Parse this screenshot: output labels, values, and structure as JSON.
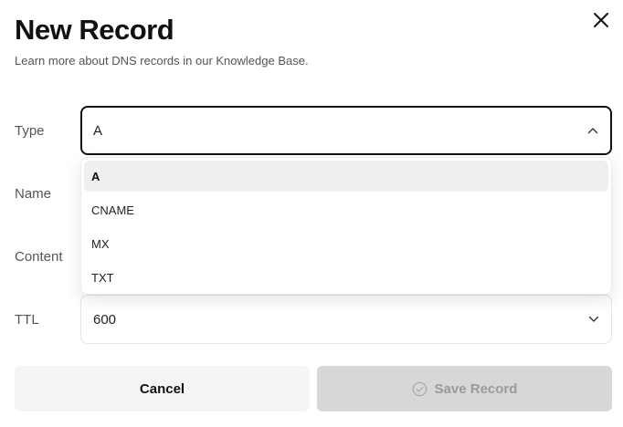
{
  "dialog": {
    "title": "New Record",
    "subtitle": "Learn more about DNS records in our Knowledge Base."
  },
  "fields": {
    "type": {
      "label": "Type",
      "value": "A"
    },
    "name": {
      "label": "Name"
    },
    "content": {
      "label": "Content"
    },
    "ttl": {
      "label": "TTL",
      "value": "600"
    }
  },
  "dropdown": {
    "options": [
      "A",
      "CNAME",
      "MX",
      "TXT"
    ],
    "selected": "A"
  },
  "actions": {
    "cancel_label": "Cancel",
    "save_label": "Save Record"
  },
  "colors": {
    "text_primary": "#111111",
    "text_secondary": "#555555",
    "cancel_bg": "#f4f5f7",
    "save_disabled_bg": "#d7d7d7",
    "save_disabled_text": "#9a9a9a",
    "option_highlight": "#efefef"
  },
  "icons": {
    "close": "close-icon",
    "type_chevron": "chevron-up-icon",
    "ttl_chevron": "chevron-down-icon",
    "save": "check-circle-icon"
  }
}
